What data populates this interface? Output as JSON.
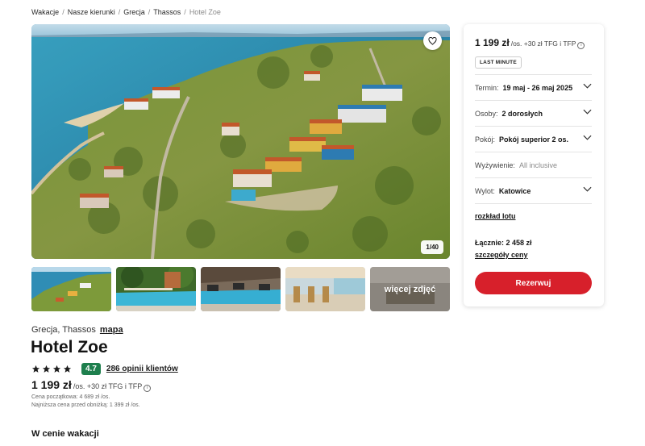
{
  "breadcrumb": {
    "items": [
      "Wakacje",
      "Nasze kierunki",
      "Grecja",
      "Thassos"
    ],
    "current": "Hotel Zoe"
  },
  "gallery": {
    "counter": "1/40",
    "more_label": "więcej zdjęć"
  },
  "hotel": {
    "location": "Grecja, Thassos",
    "map_link": "mapa",
    "name": "Hotel Zoe",
    "stars": 4,
    "score": "4.7",
    "reviews": "286 opinii klientów"
  },
  "price": {
    "amount": "1 199 zł",
    "suffix": "/os. +30 zł TFG i TFP",
    "start_price": "Cena początkowa: 4 689 zł /os.",
    "lowest_price": "Najniższa cena przed obniżką: 1 399 zł /os."
  },
  "sections": {
    "in_price": "W cenie wakacji"
  },
  "booking": {
    "amount": "1 199 zł",
    "suffix": "/os. +30 zł TFG i TFP",
    "badge": "LAST MINUTE",
    "term_label": "Termin:",
    "term_value": "19 maj - 26 maj 2025",
    "persons_label": "Osoby:",
    "persons_value": "2 dorosłych",
    "room_label": "Pokój:",
    "room_value": "Pokój superior 2 os.",
    "board_label": "Wyżywienie:",
    "board_value": "All inclusive",
    "flight_label": "Wylot:",
    "flight_value": "Katowice",
    "flight_schedule": "rozkład lotu",
    "total": "Łącznie: 2 458 zł",
    "price_details": "szczegóły ceny",
    "book_button": "Rezerwuj"
  },
  "colors": {
    "accent": "#d7202b",
    "score_bg": "#1e7f4d"
  },
  "icons": [
    "heart-icon",
    "star-icon",
    "info-icon",
    "chevron-down-icon"
  ]
}
